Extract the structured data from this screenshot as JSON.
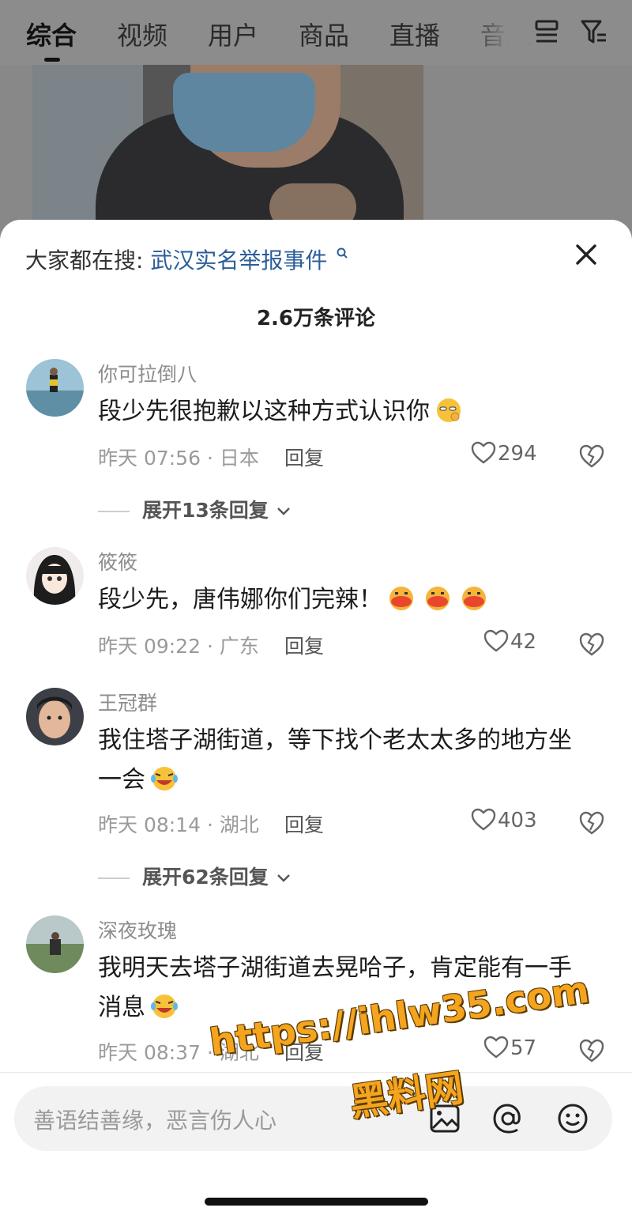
{
  "tabs": [
    {
      "label": "综合",
      "active": true
    },
    {
      "label": "视频"
    },
    {
      "label": "用户"
    },
    {
      "label": "商品"
    },
    {
      "label": "直播"
    },
    {
      "label": "音乐"
    }
  ],
  "top_icons": [
    "list-view-icon",
    "filter-icon"
  ],
  "hot_search": {
    "label": "大家都在搜:",
    "query": "武汉实名举报事件"
  },
  "comment_count": "2.6万条评论",
  "comments": [
    {
      "user": "你可拉倒八",
      "lines": [
        "段少先很抱歉以这种方式认识你"
      ],
      "emoji": [
        "thinking-emoji"
      ],
      "meta": "昨天 07:56 · 日本",
      "reply": "回复",
      "likes": "294",
      "expand": "展开13条回复"
    },
    {
      "user": "筱筱",
      "lines": [
        "段少先，唐伟娜你们完辣！"
      ],
      "emoji": [
        "clapping-emoji",
        "clapping-emoji",
        "clapping-emoji"
      ],
      "meta": "昨天 09:22 · 广东",
      "reply": "回复",
      "likes": "42"
    },
    {
      "user": "王冠群",
      "lines": [
        "我住塔子湖街道，等下找个老太太多的地方坐",
        "一会"
      ],
      "emoji": [
        "crying-laughing-emoji"
      ],
      "meta": "昨天 08:14 · 湖北",
      "reply": "回复",
      "likes": "403",
      "expand": "展开62条回复"
    },
    {
      "user": "深夜玫瑰",
      "lines": [
        "我明天去塔子湖街道去晃哈子，肯定能有一手",
        "消息"
      ],
      "emoji": [
        "crying-laughing-emoji"
      ],
      "meta": "昨天 08:37 · 湖北",
      "reply": "回复",
      "likes": "57"
    }
  ],
  "input": {
    "placeholder": "善语结善缘，恶言伤人心"
  },
  "input_icons": [
    "image-icon",
    "at-icon",
    "emoji-icon"
  ],
  "watermark": {
    "url": "https://ihlw35.com",
    "name": "黑料网"
  },
  "colors": {
    "link": "#2c5e99",
    "watermark": "#f4a41e",
    "dim_overlay": "#8c8c8c"
  }
}
